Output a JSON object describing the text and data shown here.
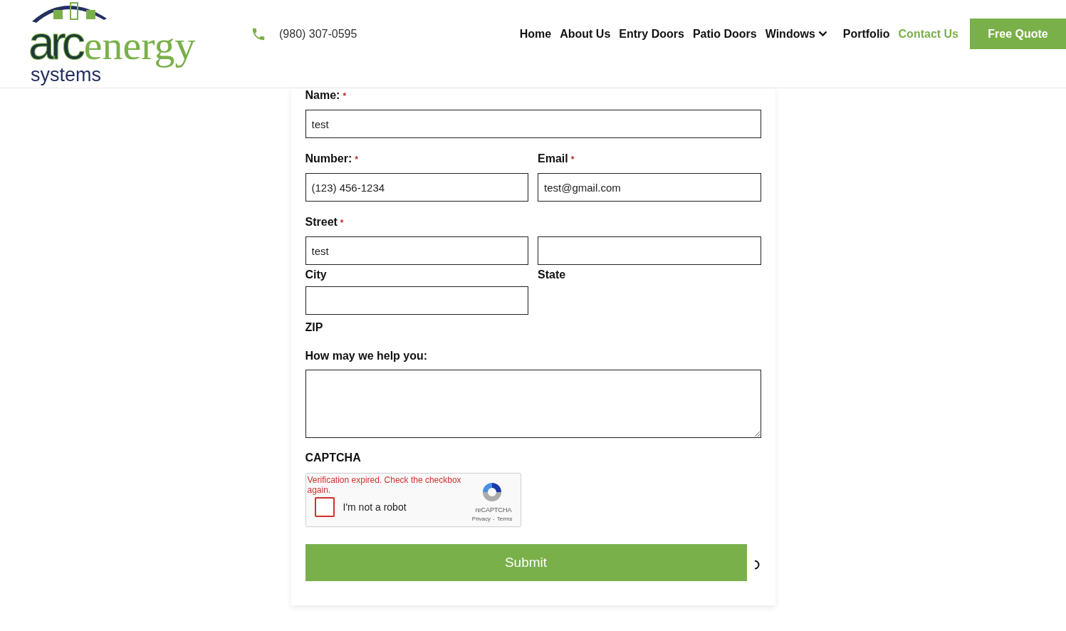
{
  "header": {
    "logo": {
      "arc": "arc",
      "energy": "energy",
      "tagline": "systems"
    },
    "phone": "(980) 307-0595",
    "nav": [
      {
        "label": "Home",
        "selected": false,
        "dropdown": false
      },
      {
        "label": "About Us",
        "selected": false,
        "dropdown": false
      },
      {
        "label": "Entry Doors",
        "selected": false,
        "dropdown": false
      },
      {
        "label": "Patio Doors",
        "selected": false,
        "dropdown": false
      },
      {
        "label": "Windows",
        "selected": false,
        "dropdown": true
      },
      {
        "label": "Portfolio",
        "selected": false,
        "dropdown": false
      },
      {
        "label": "Contact Us",
        "selected": true,
        "dropdown": false
      }
    ],
    "cta": "Free Quote"
  },
  "form": {
    "name": {
      "label": "Name:",
      "required_mark": "*",
      "value": "test"
    },
    "number": {
      "label": "Number:",
      "required_mark": "*",
      "value": "(123) 456-1234"
    },
    "email": {
      "label": "Email",
      "required_mark": "*",
      "value": "test@gmail.com"
    },
    "street": {
      "label": "Street",
      "required_mark": "*",
      "value": "test"
    },
    "city_label": "City",
    "state_label": "State",
    "zip_label": "ZIP",
    "help": {
      "label": "How may we help you:"
    },
    "captcha": {
      "label": "CAPTCHA",
      "error": "Verification expired. Check the checkbox again.",
      "checkbox_label": "I'm not a robot",
      "checked": false,
      "brand": "reCAPTCHA",
      "links": [
        "Privacy",
        "Terms"
      ],
      "separator": "-"
    },
    "submit": "Submit",
    "loading": true
  }
}
